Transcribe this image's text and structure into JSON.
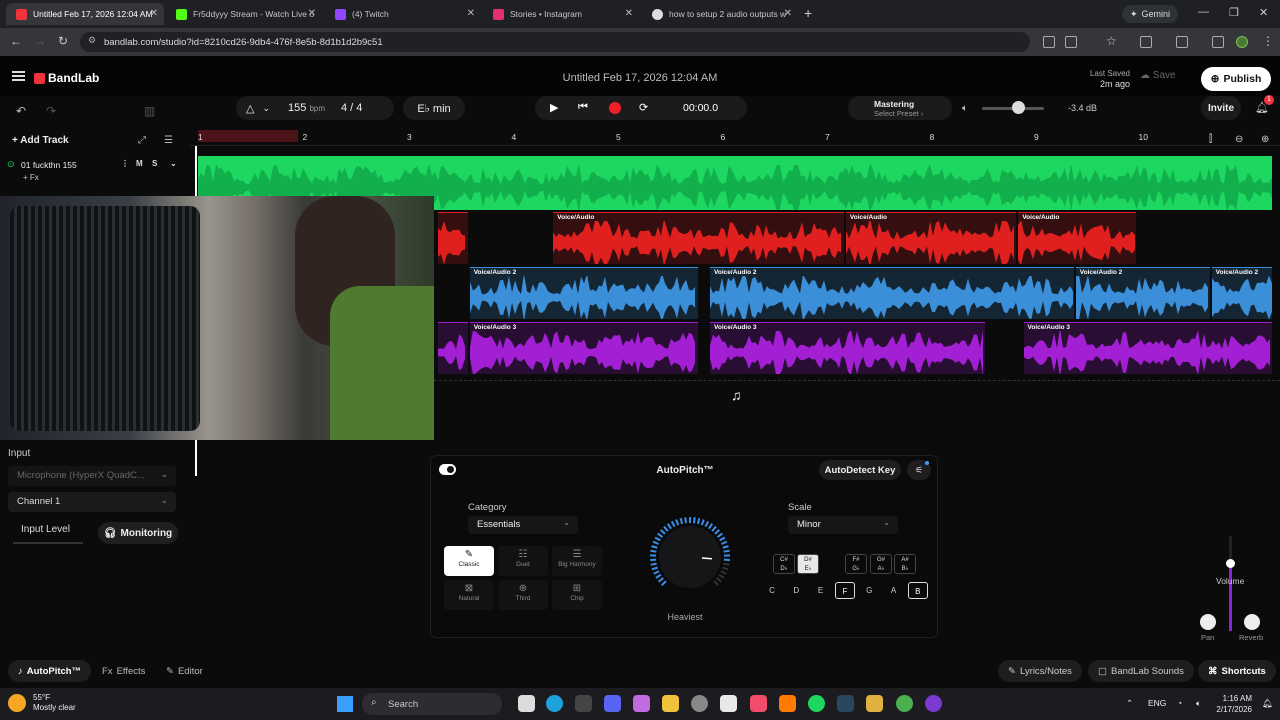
{
  "browser": {
    "tabs": [
      {
        "title": "Untitled Feb 17, 2026 12:04 AM",
        "active": true,
        "color": "#f0333c"
      },
      {
        "title": "Fr5ddyyy Stream - Watch Live o",
        "active": false,
        "color": "#53fc18"
      },
      {
        "title": "(4) Twitch",
        "active": false,
        "color": "#9146ff"
      },
      {
        "title": "Stories • Instagram",
        "active": false,
        "color": "#e1306c"
      },
      {
        "title": "how to setup 2 audio outputs w",
        "active": false,
        "color": "#dddddd"
      }
    ],
    "gemini_label": "Gemini",
    "url": "bandlab.com/studio?id=8210cd26-9db4-476f-8e5b-8d1b1d2b9c51"
  },
  "header": {
    "logo": "BandLab",
    "project_title": "Untitled Feb 17, 2026 12:04 AM",
    "last_saved_label": "Last Saved",
    "last_saved_value": "2m ago",
    "save_label": "Save",
    "publish_label": "Publish"
  },
  "toolbar": {
    "bpm": "155",
    "bpm_unit": "bpm",
    "time_signature": "4 / 4",
    "key": "E♭ min",
    "timecode": "00:00.0",
    "mastering_label": "Mastering",
    "mastering_preset": "Select Preset ›",
    "master_volume_db": "-3.4 dB",
    "master_volume_level": 0.5,
    "invite_label": "Invite",
    "notification_count": "1"
  },
  "tracks_header": {
    "add_track_label": "Add Track",
    "track_name": "01  fuckthn 155",
    "fx_label": "+ Fx",
    "mute_label": "M",
    "solo_label": "S"
  },
  "ruler": {
    "bars": [
      "1",
      "2",
      "3",
      "4",
      "5",
      "6",
      "7",
      "8",
      "9",
      "10"
    ]
  },
  "lanes": [
    {
      "name": "track-1",
      "color": "#1ed760",
      "clips": [
        {
          "label": "",
          "start_bar": 1.0,
          "end_bar": 11.3
        }
      ]
    },
    {
      "name": "track-2",
      "color": "#e0201f",
      "clips": [
        {
          "label": "",
          "start_bar": 3.3,
          "end_bar": 3.6
        },
        {
          "label": "Voice/Audio",
          "start_bar": 4.4,
          "end_bar": 7.2
        },
        {
          "label": "Voice/Audio",
          "start_bar": 7.2,
          "end_bar": 8.85
        },
        {
          "label": "Voice/Audio",
          "start_bar": 8.85,
          "end_bar": 10.0
        }
      ]
    },
    {
      "name": "track-3",
      "color": "#3b8fd8",
      "clips": [
        {
          "label": "Voice/Audio 2",
          "start_bar": 3.6,
          "end_bar": 5.8
        },
        {
          "label": "Voice/Audio 2",
          "start_bar": 5.9,
          "end_bar": 9.4
        },
        {
          "label": "Voice/Audio 2",
          "start_bar": 9.4,
          "end_bar": 10.7
        },
        {
          "label": "Voice/Audio 2",
          "start_bar": 10.7,
          "end_bar": 11.3
        }
      ]
    },
    {
      "name": "track-4",
      "color": "#a21fd4",
      "clips": [
        {
          "label": "",
          "start_bar": 3.3,
          "end_bar": 3.6
        },
        {
          "label": "Voice/Audio 3",
          "start_bar": 3.6,
          "end_bar": 5.8
        },
        {
          "label": "Voice/Audio 3",
          "start_bar": 5.9,
          "end_bar": 8.55
        },
        {
          "label": "Voice/Audio 3",
          "start_bar": 8.9,
          "end_bar": 11.3
        }
      ]
    }
  ],
  "input_panel": {
    "title": "Input",
    "device": "Microphone (HyperX QuadC...",
    "channel": "Channel 1",
    "input_level_label": "Input Level",
    "monitoring_label": "Monitoring"
  },
  "autopitch": {
    "title": "AutoPitch™",
    "autodetect_label": "AutoDetect Key",
    "category_label": "Category",
    "category_value": "Essentials",
    "presets": [
      {
        "label": "Classic",
        "icon": "✎",
        "selected": true
      },
      {
        "label": "Duet",
        "icon": "☷",
        "selected": false
      },
      {
        "label": "Big Harmony",
        "icon": "☰",
        "selected": false
      },
      {
        "label": "Natural",
        "icon": "⊠",
        "selected": false
      },
      {
        "label": "Third",
        "icon": "⊕",
        "selected": false
      },
      {
        "label": "Chip",
        "icon": "⊞",
        "selected": false
      }
    ],
    "knob_label": "Heaviest",
    "knob_level": 0.85,
    "scale_label": "Scale",
    "scale_value": "Minor",
    "sharps": [
      {
        "top": "C#",
        "bottom": "D♭",
        "active": false
      },
      {
        "top": "D#",
        "bottom": "E♭",
        "active": true
      },
      {
        "top": "F#",
        "bottom": "G♭",
        "active": false
      },
      {
        "top": "G#",
        "bottom": "A♭",
        "active": false
      },
      {
        "top": "A#",
        "bottom": "B♭",
        "active": false
      }
    ],
    "naturals": [
      {
        "label": "C",
        "active": false
      },
      {
        "label": "D",
        "active": false
      },
      {
        "label": "E",
        "active": false
      },
      {
        "label": "F",
        "active": true
      },
      {
        "label": "G",
        "active": false
      },
      {
        "label": "A",
        "active": false
      },
      {
        "label": "B",
        "active": true
      }
    ]
  },
  "mixer": {
    "volume_label": "Volume",
    "pan_label": "Pan",
    "reverb_label": "Reverb"
  },
  "bottom_bar": {
    "tabs": [
      "AutoPitch™",
      "Effects",
      "Editor"
    ],
    "lyrics_label": "Lyrics/Notes",
    "sounds_label": "BandLab Sounds",
    "shortcuts_label": "Shortcuts"
  },
  "taskbar": {
    "weather_temp": "55°F",
    "weather_desc": "Mostly clear",
    "search_label": "Search",
    "language": "ENG",
    "time": "1:16 AM",
    "date": "2/17/2026"
  }
}
